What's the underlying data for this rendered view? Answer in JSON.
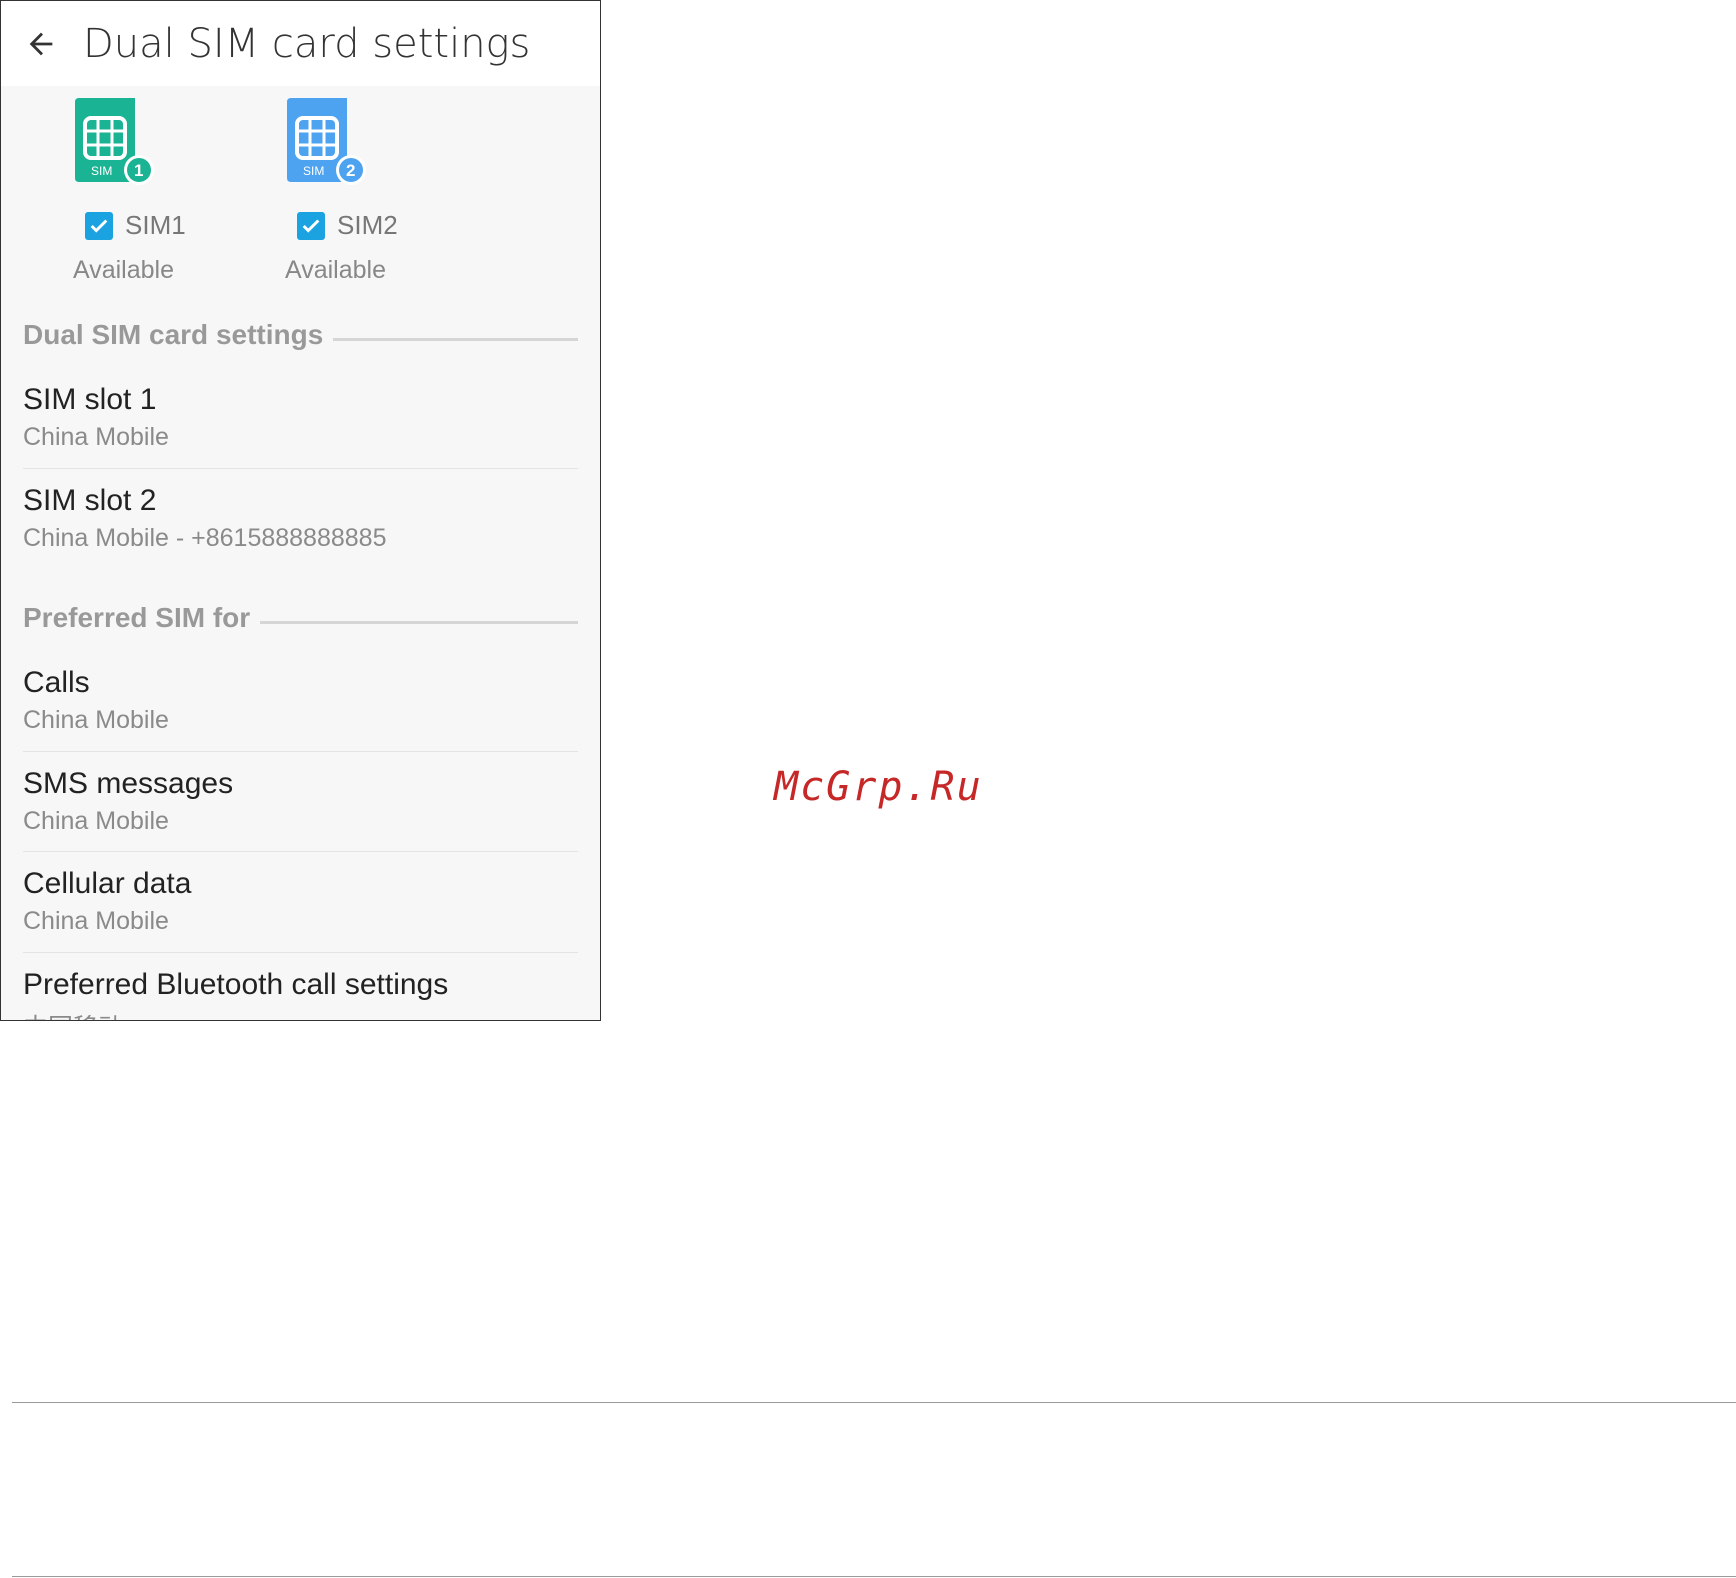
{
  "app": {
    "title": "Dual SIM card settings"
  },
  "sims": [
    {
      "label": "SIM1",
      "status": "Available",
      "checked": true,
      "badge": "1",
      "icon_text": "SIM",
      "color": "#1ab394"
    },
    {
      "label": "SIM2",
      "status": "Available",
      "checked": true,
      "badge": "2",
      "icon_text": "SIM",
      "color": "#4da3f0"
    }
  ],
  "sections": {
    "dual": {
      "header": "Dual SIM card settings",
      "items": [
        {
          "title": "SIM slot 1",
          "subtitle": "China Mobile"
        },
        {
          "title": "SIM slot 2",
          "subtitle": "China Mobile - +8615888888885"
        }
      ]
    },
    "preferred": {
      "header": "Preferred SIM for",
      "items": [
        {
          "title": "Calls",
          "subtitle": "China Mobile"
        },
        {
          "title": "SMS messages",
          "subtitle": "China Mobile"
        },
        {
          "title": "Cellular data",
          "subtitle": "China Mobile"
        },
        {
          "title": "Preferred Bluetooth call settings",
          "subtitle": "中国移动"
        }
      ]
    }
  },
  "watermark": "McGrp.Ru",
  "colors": {
    "checkbox": "#1aa3e0",
    "accent_green": "#1ab394",
    "accent_blue": "#4da3f0"
  }
}
